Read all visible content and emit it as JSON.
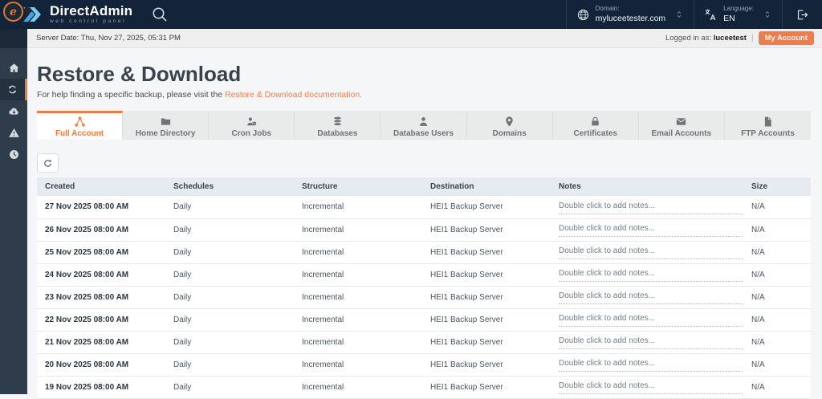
{
  "topbar": {
    "brand": {
      "name": "DirectAdmin",
      "tagline": "web control panel"
    },
    "domain": {
      "label": "Domain:",
      "value": "myluceetester.com"
    },
    "language": {
      "label": "Language:",
      "value": "EN"
    }
  },
  "statusbar": {
    "server_date": "Server Date: Thu, Nov 27, 2025, 05:31 PM",
    "logged_in_label": "Logged in as:",
    "username": "luceetest",
    "separator": "|",
    "my_account_label": "My Account"
  },
  "sidebar": {
    "items": [
      {
        "name": "home",
        "icon": "home",
        "active": false
      },
      {
        "name": "restore",
        "icon": "sync",
        "active": true
      },
      {
        "name": "backups",
        "icon": "cloud-down",
        "active": false
      },
      {
        "name": "alerts",
        "icon": "warning",
        "active": false
      },
      {
        "name": "history",
        "icon": "clock",
        "active": false
      }
    ]
  },
  "page": {
    "title": "Restore & Download",
    "subtitle_prefix": "For help finding a specific backup, please visit the ",
    "subtitle_link": "Restore & Download documentation."
  },
  "tabs": [
    {
      "label": "Full Account",
      "icon": "share",
      "active": true
    },
    {
      "label": "Home Directory",
      "icon": "folder",
      "active": false
    },
    {
      "label": "Cron Jobs",
      "icon": "cron",
      "active": false
    },
    {
      "label": "Databases",
      "icon": "database",
      "active": false
    },
    {
      "label": "Database Users",
      "icon": "user",
      "active": false
    },
    {
      "label": "Domains",
      "icon": "pin",
      "active": false
    },
    {
      "label": "Certificates",
      "icon": "lock",
      "active": false
    },
    {
      "label": "Email Accounts",
      "icon": "mail",
      "active": false
    },
    {
      "label": "FTP Accounts",
      "icon": "file",
      "active": false
    }
  ],
  "table": {
    "columns": [
      "Created",
      "Schedules",
      "Structure",
      "Destination",
      "Notes",
      "Size"
    ],
    "rows": [
      {
        "created": "27 Nov 2025 08:00 AM",
        "schedules": "Daily",
        "structure": "Incremental",
        "destination": "HEI1 Backup Server",
        "notes": "Double click to add notes...",
        "size": "N/A"
      },
      {
        "created": "26 Nov 2025 08:00 AM",
        "schedules": "Daily",
        "structure": "Incremental",
        "destination": "HEI1 Backup Server",
        "notes": "Double click to add notes...",
        "size": "N/A"
      },
      {
        "created": "25 Nov 2025 08:00 AM",
        "schedules": "Daily",
        "structure": "Incremental",
        "destination": "HEI1 Backup Server",
        "notes": "Double click to add notes...",
        "size": "N/A"
      },
      {
        "created": "24 Nov 2025 08:00 AM",
        "schedules": "Daily",
        "structure": "Incremental",
        "destination": "HEI1 Backup Server",
        "notes": "Double click to add notes...",
        "size": "N/A"
      },
      {
        "created": "23 Nov 2025 08:00 AM",
        "schedules": "Daily",
        "structure": "Incremental",
        "destination": "HEI1 Backup Server",
        "notes": "Double click to add notes...",
        "size": "N/A"
      },
      {
        "created": "22 Nov 2025 08:00 AM",
        "schedules": "Daily",
        "structure": "Incremental",
        "destination": "HEI1 Backup Server",
        "notes": "Double click to add notes...",
        "size": "N/A"
      },
      {
        "created": "21 Nov 2025 08:00 AM",
        "schedules": "Daily",
        "structure": "Incremental",
        "destination": "HEI1 Backup Server",
        "notes": "Double click to add notes...",
        "size": "N/A"
      },
      {
        "created": "20 Nov 2025 08:00 AM",
        "schedules": "Daily",
        "structure": "Incremental",
        "destination": "HEI1 Backup Server",
        "notes": "Double click to add notes...",
        "size": "N/A"
      },
      {
        "created": "19 Nov 2025 08:00 AM",
        "schedules": "Daily",
        "structure": "Incremental",
        "destination": "HEI1 Backup Server",
        "notes": "Double click to add notes...",
        "size": "N/A"
      }
    ]
  },
  "colors": {
    "accent_orange": "#ed7b3f",
    "link_orange": "#f07f4e",
    "topbar_navy": "#13243a",
    "sidebar_slate": "#2e3c4c",
    "brand_blue": "#5fb8e6",
    "table_header_bg": "#e6ebf1"
  }
}
